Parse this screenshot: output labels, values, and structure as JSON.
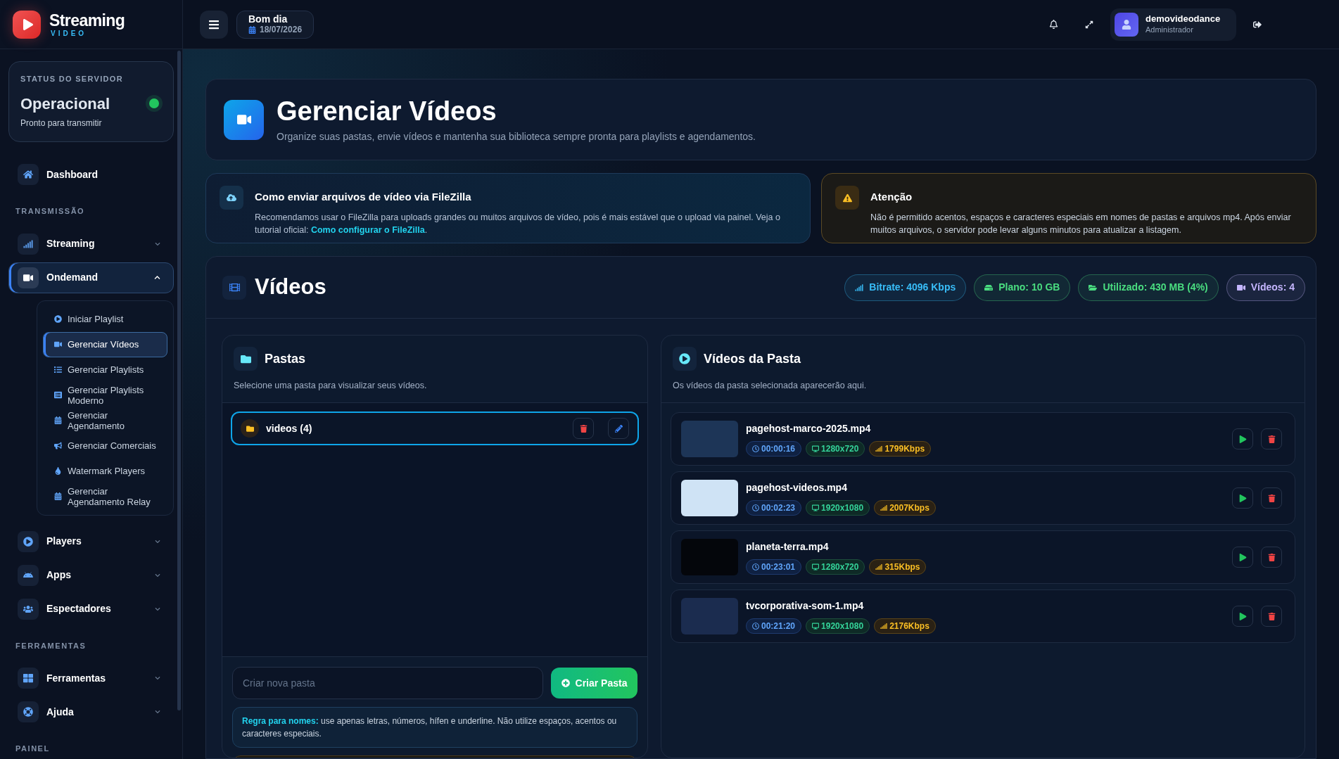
{
  "brand": {
    "name": "Streaming",
    "tagline": "VIDEO"
  },
  "topbar": {
    "greeting": "Bom dia",
    "date": "18/07/2026",
    "user": {
      "name": "demovideodance",
      "role": "Administrador"
    }
  },
  "sidebar": {
    "server_status": {
      "heading": "STATUS DO SERVIDOR",
      "state": "Operacional",
      "detail": "Pronto para transmitir",
      "online": true
    },
    "groups": [
      {
        "items": [
          {
            "label": "Dashboard",
            "selected": false
          }
        ]
      },
      {
        "heading": "TRANSMISSÃO",
        "items": [
          {
            "label": "Streaming",
            "selected": false,
            "expanded": false
          },
          {
            "label": "Ondemand",
            "selected": true,
            "expanded": true,
            "children": [
              {
                "label": "Iniciar Playlist",
                "selected": false
              },
              {
                "label": "Gerenciar Vídeos",
                "selected": true
              },
              {
                "label": "Gerenciar Playlists",
                "selected": false
              },
              {
                "label": "Gerenciar Playlists Moderno",
                "selected": false
              },
              {
                "label": "Gerenciar Agendamento",
                "selected": false
              },
              {
                "label": "Gerenciar Comerciais",
                "selected": false
              },
              {
                "label": "Watermark Players",
                "selected": false
              },
              {
                "label": "Gerenciar Agendamento Relay",
                "selected": false
              }
            ]
          },
          {
            "label": "Players",
            "selected": false,
            "expanded": false
          },
          {
            "label": "Apps",
            "selected": false,
            "expanded": false
          },
          {
            "label": "Espectadores",
            "selected": false,
            "expanded": false
          }
        ]
      },
      {
        "heading": "FERRAMENTAS",
        "items": [
          {
            "label": "Ferramentas",
            "selected": false,
            "expanded": false
          },
          {
            "label": "Ajuda",
            "selected": false,
            "expanded": false
          }
        ]
      },
      {
        "heading": "PAINEL"
      }
    ]
  },
  "page": {
    "title": "Gerenciar Vídeos",
    "subtitle": "Organize suas pastas, envie vídeos e mantenha sua biblioteca sempre pronta para playlists e agendamentos."
  },
  "notices": [
    {
      "kind": "info",
      "title": "Como enviar arquivos de vídeo via FileZilla",
      "text": "Recomendamos usar o FileZilla para uploads grandes ou muitos arquivos de vídeo, pois é mais estável que o upload via painel. Veja o tutorial oficial:",
      "link": "Como configurar o FileZilla",
      "text_after": "."
    },
    {
      "kind": "warning",
      "title": "Atenção",
      "text": "Não é permitido acentos, espaços e caracteres especiais em nomes de pastas e arquivos mp4. Após enviar muitos arquivos, o servidor pode levar alguns minutos para atualizar a listagem."
    }
  ],
  "library": {
    "title": "Vídeos",
    "stats": [
      {
        "kind": "bitrate",
        "label": "Bitrate: 4096 Kbps",
        "color": "#38bdf8"
      },
      {
        "kind": "plan",
        "label": "Plano: 10 GB",
        "color": "#4ade80"
      },
      {
        "kind": "used",
        "label": "Utilizado: 430 MB (4%)",
        "color": "#4ade80"
      },
      {
        "kind": "count",
        "label": "Vídeos: 4",
        "color": "#c4b5fd"
      }
    ],
    "folders_panel": {
      "title": "Pastas",
      "subtitle": "Selecione uma pasta para visualizar seus vídeos.",
      "folders": [
        {
          "name": "videos (4)",
          "selected": true
        }
      ],
      "new_folder": {
        "placeholder": "Criar nova pasta",
        "button": "Criar Pasta"
      },
      "rule": "**Regra para nomes:** use apenas letras, números, hífen e underline. Não utilize espaços, acentos ou caracteres especiais."
    },
    "videos_panel": {
      "title": "Vídeos da Pasta",
      "subtitle": "Os vídeos da pasta selecionada aparecerão aqui.",
      "videos": [
        {
          "name": "pagehost-marco-2025.mp4",
          "duration": "00:00:16",
          "resolution": "1280x720",
          "bitrate": "1799Kbps"
        },
        {
          "name": "pagehost-videos.mp4",
          "duration": "00:02:23",
          "resolution": "1920x1080",
          "bitrate": "2007Kbps"
        },
        {
          "name": "planeta-terra.mp4",
          "duration": "00:23:01",
          "resolution": "1280x720",
          "bitrate": "315Kbps"
        },
        {
          "name": "tvcorporativa-som-1.mp4",
          "duration": "00:21:20",
          "resolution": "1920x1080",
          "bitrate": "2176Kbps"
        }
      ]
    }
  }
}
